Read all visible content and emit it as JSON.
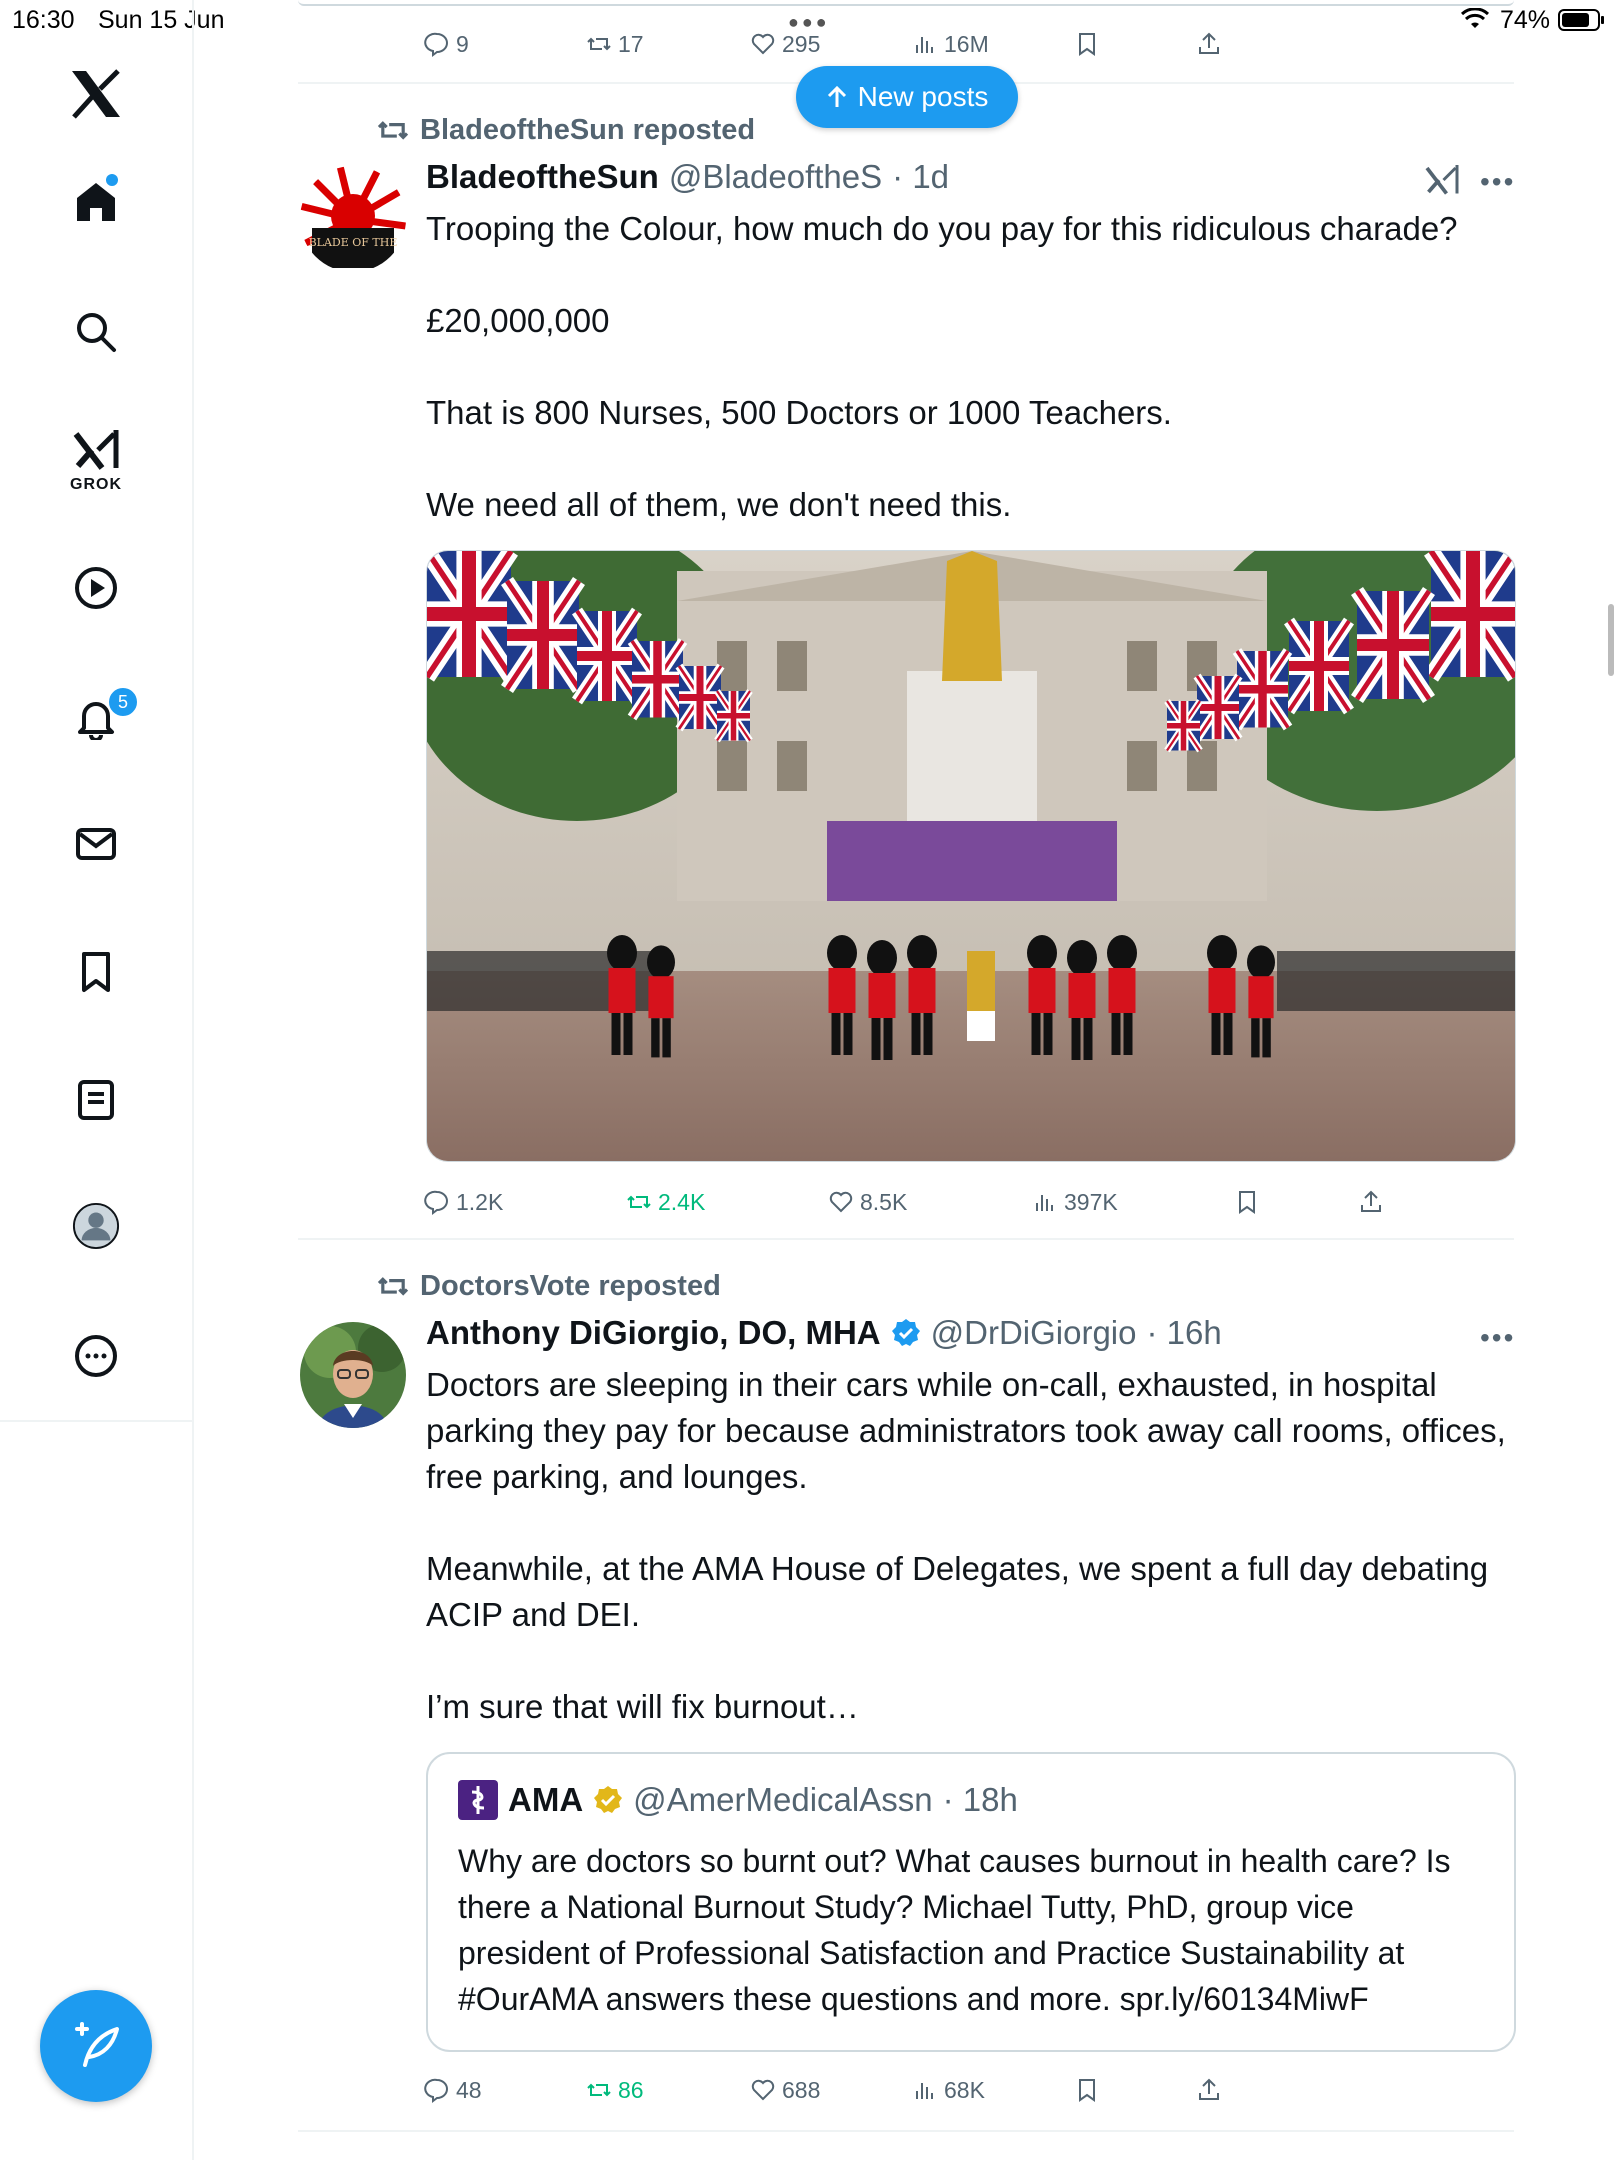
{
  "status_bar": {
    "time": "16:30",
    "date": "Sun 15 Jun",
    "battery": "74%"
  },
  "sidebar": {
    "items": [
      "home",
      "search",
      "grok",
      "video",
      "notifications",
      "messages",
      "bookmarks",
      "lists",
      "profile",
      "more"
    ],
    "grok_label": "GROK",
    "notifications_count": "5"
  },
  "top_post_actions": {
    "replies": "9",
    "reposts": "17",
    "likes": "295",
    "views": "16M"
  },
  "new_posts_label": "New posts",
  "post1": {
    "reposted_by": "BladeoftheSun reposted",
    "name": "BladeoftheSun",
    "handle": "@BladeoftheS",
    "time": "· 1d",
    "avatar_text": "BLADE OF THE",
    "paragraphs": [
      "Trooping the Colour, how much do you pay for this ridiculous charade?",
      "£20,000,000",
      "That is 800 Nurses, 500 Doctors or 1000 Teachers.",
      "We need all of them, we don't need this."
    ],
    "actions": {
      "replies": "1.2K",
      "reposts": "2.4K",
      "likes": "8.5K",
      "views": "397K"
    }
  },
  "post2": {
    "reposted_by": "DoctorsVote reposted",
    "name": "Anthony DiGiorgio, DO, MHA",
    "handle": "@DrDiGiorgio",
    "time": "· 16h",
    "paragraphs": [
      "Doctors are sleeping in their cars while on-call, exhausted, in hospital parking  they pay for because administrators took away call rooms, offices, free parking, and lounges.",
      "Meanwhile, at the AMA House of Delegates, we spent a full day debating ACIP and DEI.",
      "I’m sure that will fix burnout…"
    ],
    "quote": {
      "name": "AMA",
      "handle": "@AmerMedicalAssn",
      "time": "· 18h",
      "text": "Why are doctors so burnt out? What causes burnout in health care? Is there a National Burnout Study? Michael Tutty, PhD, group vice president of Professional Satisfaction and Practice Sustainability at #OurAMA answers these questions and more. spr.ly/60134MiwF"
    },
    "actions": {
      "replies": "48",
      "reposts": "86",
      "likes": "688",
      "views": "68K"
    }
  },
  "colors": {
    "accent": "#1d9bf0",
    "repost_green": "#00ba7c",
    "muted": "#536471",
    "verified_gold": "#e2b719"
  }
}
